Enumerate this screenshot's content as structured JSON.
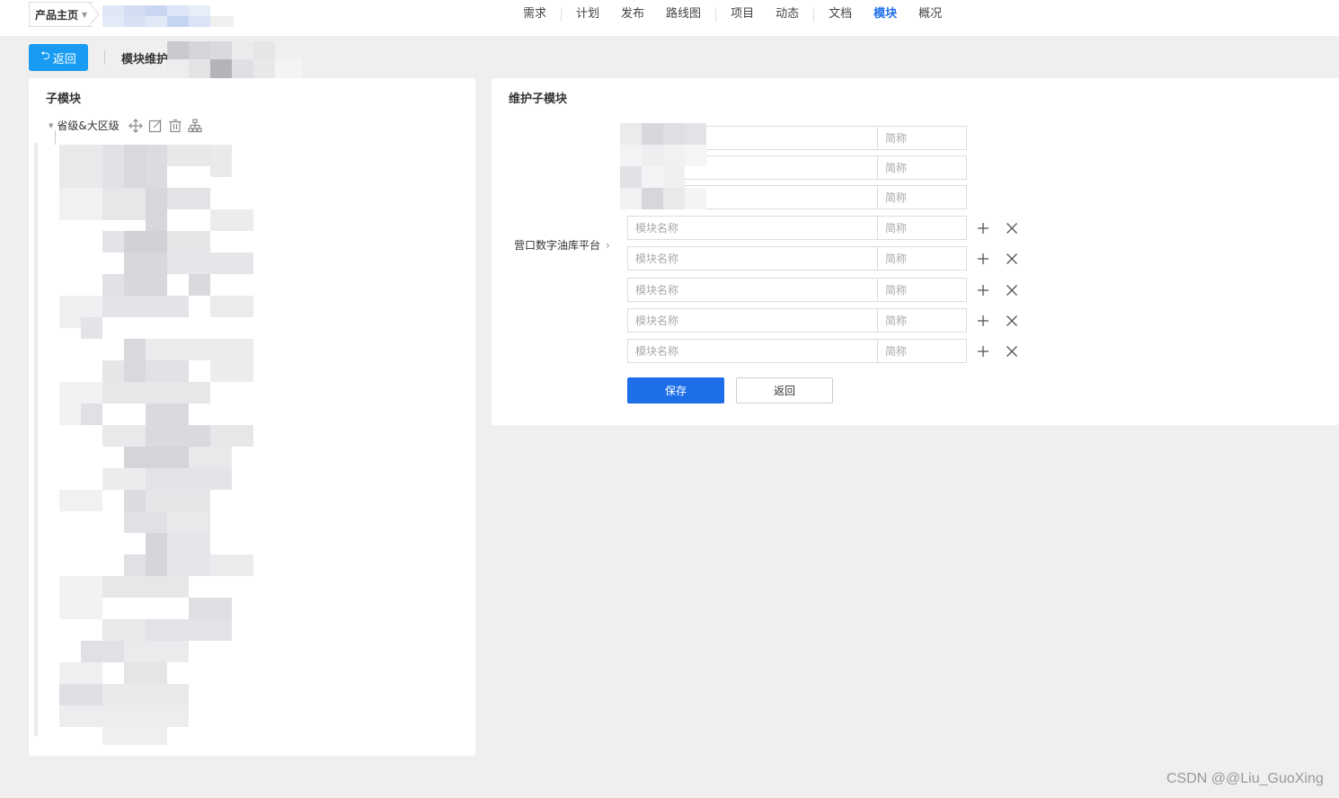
{
  "topbar": {
    "product_switch": "产品主页",
    "nav": [
      {
        "label": "需求",
        "active": false
      },
      {
        "label": "计划",
        "active": false
      },
      {
        "label": "发布",
        "active": false
      },
      {
        "label": "路线图",
        "active": false
      },
      {
        "label": "项目",
        "active": false
      },
      {
        "label": "动态",
        "active": false
      },
      {
        "label": "文档",
        "active": false
      },
      {
        "label": "模块",
        "active": true
      },
      {
        "label": "概况",
        "active": false
      }
    ]
  },
  "subheader": {
    "back_label": "返回",
    "title": "模块维护"
  },
  "left_panel": {
    "title": "子模块",
    "tree_root": "省级&大区级"
  },
  "right_panel": {
    "title": "维护子模块",
    "parent_module": "营口数字油库平台",
    "existing_rows": [
      {
        "abbr_placeholder": "简称"
      },
      {
        "abbr_placeholder": "简称"
      },
      {
        "abbr_placeholder": "简称"
      }
    ],
    "new_rows": [
      {
        "name_placeholder": "模块名称",
        "abbr_placeholder": "简称"
      },
      {
        "name_placeholder": "模块名称",
        "abbr_placeholder": "简称"
      },
      {
        "name_placeholder": "模块名称",
        "abbr_placeholder": "简称"
      },
      {
        "name_placeholder": "模块名称",
        "abbr_placeholder": "简称"
      },
      {
        "name_placeholder": "模块名称",
        "abbr_placeholder": "简称"
      }
    ],
    "save_label": "保存",
    "return_label": "返回"
  },
  "colors": {
    "primary": "#1e6ee8",
    "back_button": "#1a9bf3",
    "background": "#efefef"
  },
  "watermark": "CSDN @@Liu_GuoXing"
}
